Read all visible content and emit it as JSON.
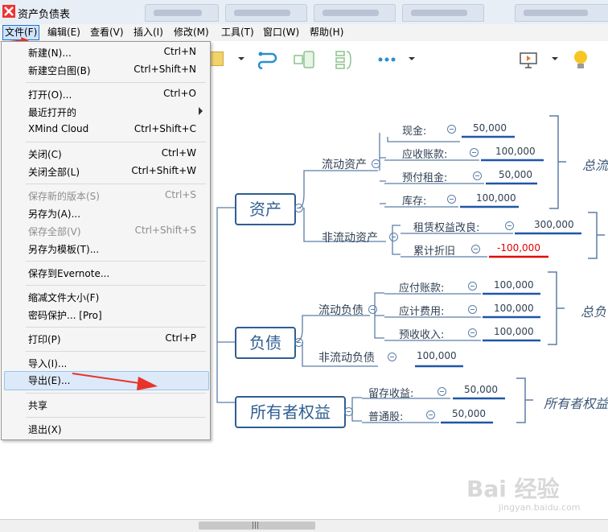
{
  "window": {
    "title": "资产负债表"
  },
  "menubar": [
    "文件(F)",
    "编辑(E)",
    "查看(V)",
    "插入(I)",
    "修改(M)",
    "工具(T)",
    "窗口(W)",
    "帮助(H)"
  ],
  "file_menu": {
    "items": [
      {
        "label": "新建(N)...",
        "shortcut": "Ctrl+N"
      },
      {
        "label": "新建空白图(B)",
        "shortcut": "Ctrl+Shift+N"
      },
      {
        "label": "打开(O)...",
        "shortcut": "Ctrl+O"
      },
      {
        "label": "最近打开的",
        "shortcut": ""
      },
      {
        "label": "XMind Cloud",
        "shortcut": "Ctrl+Shift+C"
      },
      {
        "label": "关闭(C)",
        "shortcut": "Ctrl+W"
      },
      {
        "label": "关闭全部(L)",
        "shortcut": "Ctrl+Shift+W"
      },
      {
        "label": "保存新的版本(S)",
        "shortcut": "Ctrl+S"
      },
      {
        "label": "另存为(A)...",
        "shortcut": ""
      },
      {
        "label": "保存全部(V)",
        "shortcut": "Ctrl+Shift+S"
      },
      {
        "label": "另存为模板(T)...",
        "shortcut": ""
      },
      {
        "label": "保存到Evernote...",
        "shortcut": ""
      },
      {
        "label": "缩减文件大小(F)",
        "shortcut": ""
      },
      {
        "label": "密码保护... [Pro]",
        "shortcut": ""
      },
      {
        "label": "打印(P)",
        "shortcut": "Ctrl+P"
      },
      {
        "label": "导入(I)...",
        "shortcut": ""
      },
      {
        "label": "导出(E)...",
        "shortcut": ""
      },
      {
        "label": "共享",
        "shortcut": ""
      },
      {
        "label": "退出(X)",
        "shortcut": ""
      }
    ]
  },
  "mindmap": {
    "assets": {
      "label": "资产",
      "current": {
        "label": "流动资产",
        "items": [
          {
            "label": "现金:",
            "value": "50,000"
          },
          {
            "label": "应收账款:",
            "value": "100,000"
          },
          {
            "label": "预付租金:",
            "value": "50,000"
          },
          {
            "label": "库存:",
            "value": "100,000"
          }
        ],
        "summary": "总流"
      },
      "noncurrent": {
        "label": "非流动资产",
        "items": [
          {
            "label": "租赁权益改良:",
            "value": "300,000"
          },
          {
            "label": "累计折旧",
            "value": "-100,000"
          }
        ]
      }
    },
    "liabilities": {
      "label": "负债",
      "current": {
        "label": "流动负债",
        "items": [
          {
            "label": "应付账款:",
            "value": "100,000"
          },
          {
            "label": "应计费用:",
            "value": "100,000"
          },
          {
            "label": "预收收入:",
            "value": "100,000"
          }
        ],
        "summary": "总负"
      },
      "noncurrent": {
        "label": "非流动负债",
        "value": "100,000"
      }
    },
    "equity": {
      "label": "所有者权益",
      "items": [
        {
          "label": "留存收益:",
          "value": "50,000"
        },
        {
          "label": "普通股:",
          "value": "50,000"
        }
      ],
      "summary": "所有者权益"
    }
  },
  "watermark": {
    "text": "Bai 经验",
    "sub": "jingyan.baidu.com"
  },
  "colors": {
    "accent": "#2a8fd0",
    "node": "#2f5e92",
    "negative": "#e00000",
    "underline": "#1f56a8"
  }
}
